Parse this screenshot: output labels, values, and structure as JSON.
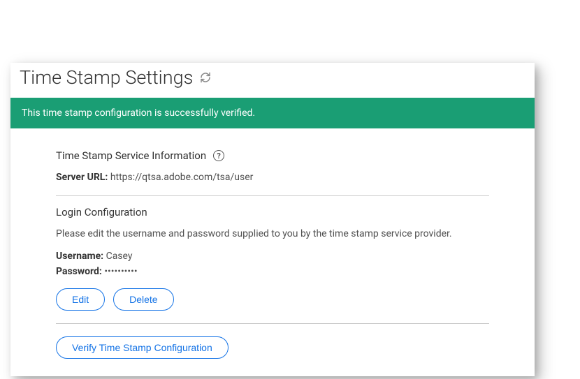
{
  "page": {
    "title": "Time Stamp Settings"
  },
  "banner": {
    "message": "This time stamp configuration is successfully verified."
  },
  "serviceInfo": {
    "heading": "Time Stamp Service Information",
    "serverUrlLabel": "Server URL:",
    "serverUrlValue": "https://qtsa.adobe.com/tsa/user"
  },
  "loginConfig": {
    "heading": "Login Configuration",
    "instruction": "Please edit the username and password supplied to you by the time stamp service provider.",
    "usernameLabel": "Username:",
    "usernameValue": "Casey",
    "passwordLabel": "Password:",
    "passwordValue": "••••••••••"
  },
  "buttons": {
    "edit": "Edit",
    "delete": "Delete",
    "verify": "Verify Time Stamp Configuration"
  }
}
